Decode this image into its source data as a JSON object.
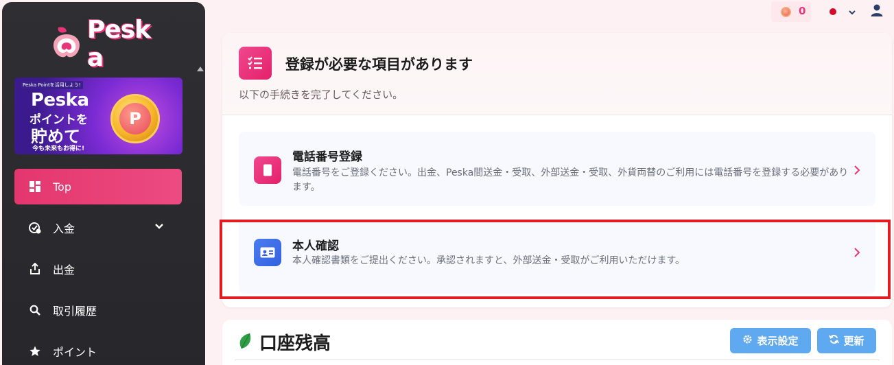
{
  "brand": {
    "logo_text": "Pesk a"
  },
  "banner": {
    "small": "Peska Pointを活用しよう!",
    "line1": "Peska",
    "line2": "ポイントを",
    "line3": "貯めて",
    "line4": "今も未来もお得に!",
    "coin_letter": "P"
  },
  "sidebar": {
    "items": [
      {
        "label": "Top",
        "icon": "dashboard-icon",
        "active": true
      },
      {
        "label": "入金",
        "icon": "deposit-icon",
        "has_submenu": true
      },
      {
        "label": "出金",
        "icon": "withdraw-icon"
      },
      {
        "label": "取引履歴",
        "icon": "search-icon"
      },
      {
        "label": "ポイント",
        "icon": "star-icon"
      }
    ]
  },
  "header": {
    "points": "0"
  },
  "notice": {
    "title": "登録が必要な項目があります",
    "subtitle": "以下の手続きを完了してください。",
    "tasks": [
      {
        "title": "電話番号登録",
        "description": "電話番号をご登録ください。出金、Peska間送金・受取、外部送金・受取、外貨両替のご利用には電話番号を登録する必要があります。",
        "icon": "phone-icon"
      },
      {
        "title": "本人確認",
        "description": "本人確認書類をご提出ください。承認されますと、外部送金・受取がご利用いただけます。",
        "icon": "id-card-icon"
      }
    ]
  },
  "balance": {
    "title": "口座残高",
    "display_settings_label": "表示設定",
    "refresh_label": "更新"
  },
  "colors": {
    "accent": "#e8357a",
    "highlight": "#e11d23",
    "button": "#5ea9ef"
  }
}
